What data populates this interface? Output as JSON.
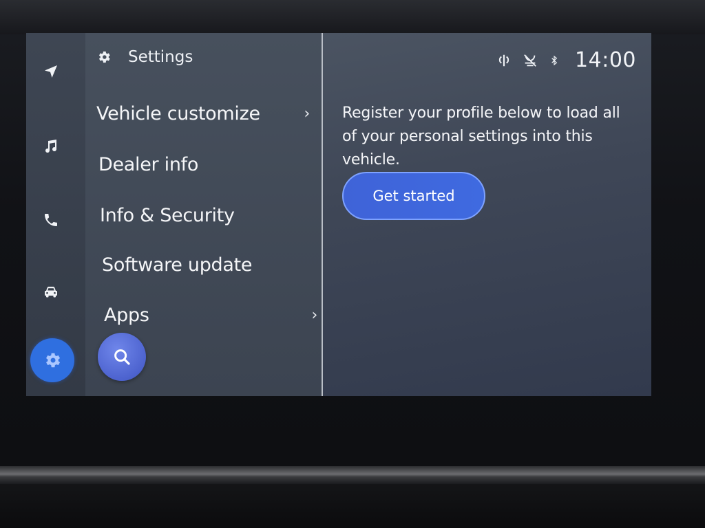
{
  "sidebar": {
    "rail": [
      {
        "name": "navigation",
        "icon": "navigation-arrow-icon"
      },
      {
        "name": "music",
        "icon": "music-note-icon"
      },
      {
        "name": "phone",
        "icon": "phone-icon"
      },
      {
        "name": "vehicle",
        "icon": "car-icon"
      },
      {
        "name": "settings",
        "icon": "gear-icon",
        "active": true
      }
    ]
  },
  "menu": {
    "title": "Settings",
    "title_icon": "gear-icon",
    "items": [
      {
        "label": "Vehicle customize",
        "chevron": "›"
      },
      {
        "label": "Dealer info"
      },
      {
        "label": "Info & Security"
      },
      {
        "label": "Software update"
      },
      {
        "label": "Apps",
        "chevron": "›"
      }
    ],
    "search_icon": "search-icon"
  },
  "status": {
    "icons": [
      "wireless-charging-icon",
      "voice-muted-icon",
      "bluetooth-icon"
    ],
    "time": "14:00"
  },
  "content": {
    "message": "Register your profile below to load all of your personal settings into this vehicle.",
    "button_label": "Get started"
  },
  "colors": {
    "accent": "#2f6fe0",
    "button": "#3f63d8",
    "panel": "#47505d"
  }
}
